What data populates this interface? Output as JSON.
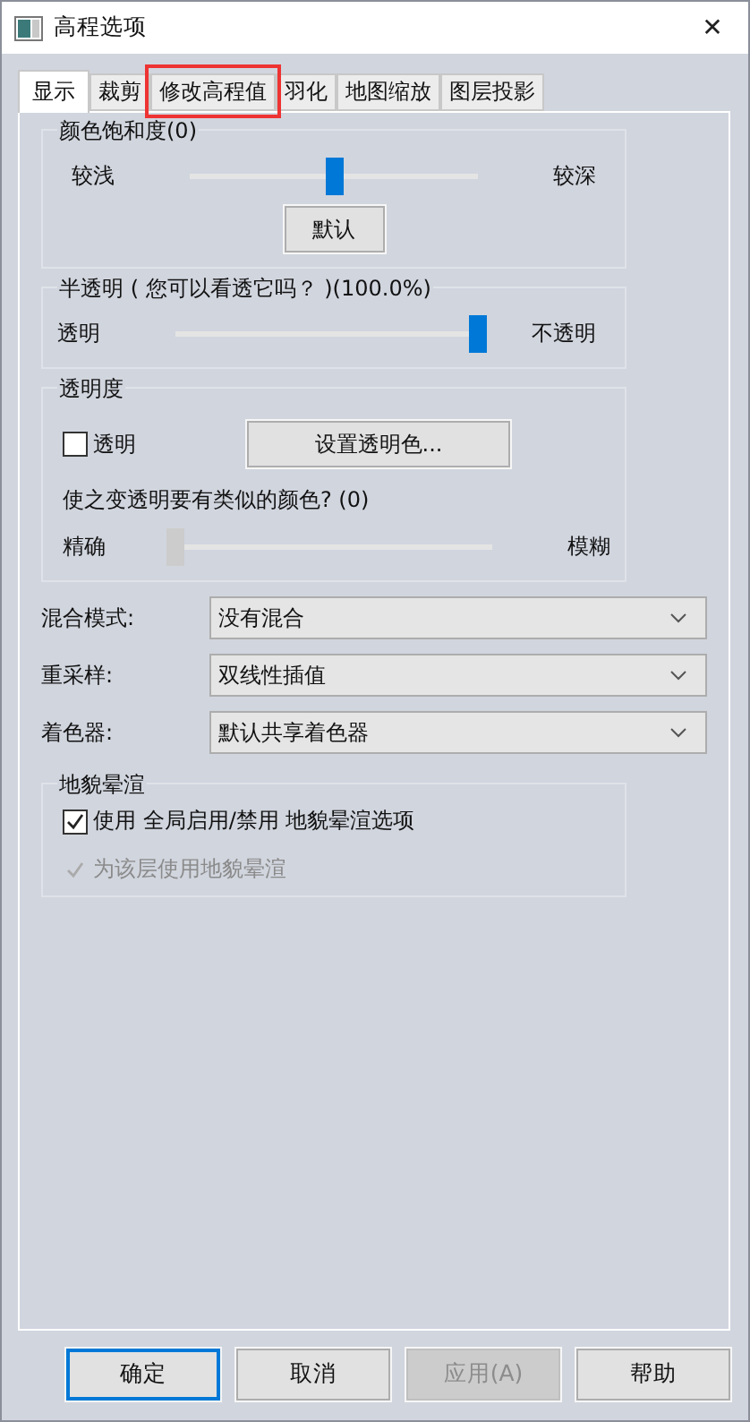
{
  "window": {
    "title": "高程选项",
    "close": "✕"
  },
  "tabs": [
    {
      "label": "显示",
      "selected": true,
      "highlighted": false
    },
    {
      "label": "裁剪",
      "selected": false,
      "highlighted": false
    },
    {
      "label": "修改高程值",
      "selected": false,
      "highlighted": true
    },
    {
      "label": "羽化",
      "selected": false,
      "highlighted": false
    },
    {
      "label": "地图缩放",
      "selected": false,
      "highlighted": false
    },
    {
      "label": "图层投影",
      "selected": false,
      "highlighted": false
    }
  ],
  "saturation": {
    "title": "颜色饱和度(0)",
    "left": "较浅",
    "right": "较深",
    "level": 0.5,
    "disabled": false,
    "button": "默认"
  },
  "opacity": {
    "title": "半透明 ( 您可以看透它吗？ )(100.0%)",
    "left": "透明",
    "right": "不透明",
    "level": 1.0,
    "disabled": false
  },
  "transparency": {
    "title": "透明度",
    "checkbox": {
      "label": "透明",
      "checked": false
    },
    "button": "设置透明色...",
    "similar": "使之变透明要有类似的颜色? (0)",
    "left": "精确",
    "right": "模糊",
    "level": 0.0,
    "disabled": true
  },
  "combos": [
    {
      "label": "混合模式:",
      "value": "没有混合"
    },
    {
      "label": "重采样:",
      "value": "双线性插值"
    },
    {
      "label": "着色器:",
      "value": "默认共享着色器"
    }
  ],
  "hillshade": {
    "title": "地貌晕渲",
    "options": [
      {
        "label": "使用 全局启用/禁用 地貌晕渲选项",
        "checked": true,
        "disabled": false
      },
      {
        "label": "为该层使用地貌晕渲",
        "checked": true,
        "disabled": true
      }
    ]
  },
  "buttons": [
    {
      "label": "确定",
      "default": true,
      "disabled": false
    },
    {
      "label": "取消",
      "default": false,
      "disabled": false
    },
    {
      "label": "应用(A)",
      "default": false,
      "disabled": true
    },
    {
      "label": "帮助",
      "default": false,
      "disabled": false
    }
  ]
}
